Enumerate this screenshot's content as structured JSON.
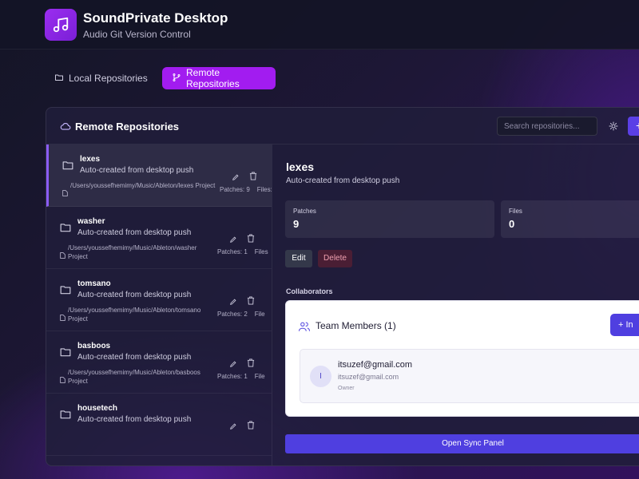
{
  "header": {
    "title": "SoundPrivate Desktop",
    "subtitle": "Audio Git Version Control",
    "logo_icon": "music-note-icon"
  },
  "tabs": [
    {
      "label": "Local Repositories",
      "icon": "folder-icon",
      "active": false
    },
    {
      "label": "Remote Repositories",
      "icon": "git-branch-icon",
      "active": true
    }
  ],
  "panel": {
    "title": "Remote Repositories",
    "search_placeholder": "Search repositories...",
    "add_label": "+"
  },
  "repositories": [
    {
      "name": "lexes",
      "description": "Auto-created from desktop push",
      "path": "/Users/youssefhemimy/Music/Ableton/lexes Project",
      "patches": "Patches: 9",
      "files": "Files:",
      "active": true
    },
    {
      "name": "washer",
      "description": "Auto-created from desktop push",
      "path": "/Users/youssefhemimy/Music/Ableton/washer Project",
      "patches": "Patches: 1",
      "files": "Files",
      "active": false
    },
    {
      "name": "tomsano",
      "description": "Auto-created from desktop push",
      "path": "/Users/youssefhemimy/Music/Ableton/tomsano Project",
      "patches": "Patches: 2",
      "files": "File",
      "active": false
    },
    {
      "name": "basboos",
      "description": "Auto-created from desktop push",
      "path": "/Users/youssefhemimy/Music/Ableton/basboos Project",
      "patches": "Patches: 1",
      "files": "File",
      "active": false
    },
    {
      "name": "housetech",
      "description": "Auto-created from desktop push",
      "path": "",
      "patches": "",
      "files": "",
      "active": false
    }
  ],
  "detail": {
    "title": "lexes",
    "description": "Auto-created from desktop push",
    "stats": [
      {
        "label": "Patches",
        "value": "9"
      },
      {
        "label": "Files",
        "value": "0"
      }
    ],
    "edit_label": "Edit",
    "delete_label": "Delete",
    "collaborators_label": "Collaborators",
    "team_title": "Team Members (1)",
    "invite_label": "+  In",
    "members": [
      {
        "initial": "I",
        "name": "itsuzef@gmail.com",
        "email": "itsuzef@gmail.com",
        "role": "Owner"
      }
    ],
    "sync_label": "Open Sync Panel"
  },
  "colors": {
    "accent_purple": "#a21cf0",
    "primary_indigo": "#4f3fe0",
    "active_border": "#8b5cf6"
  }
}
